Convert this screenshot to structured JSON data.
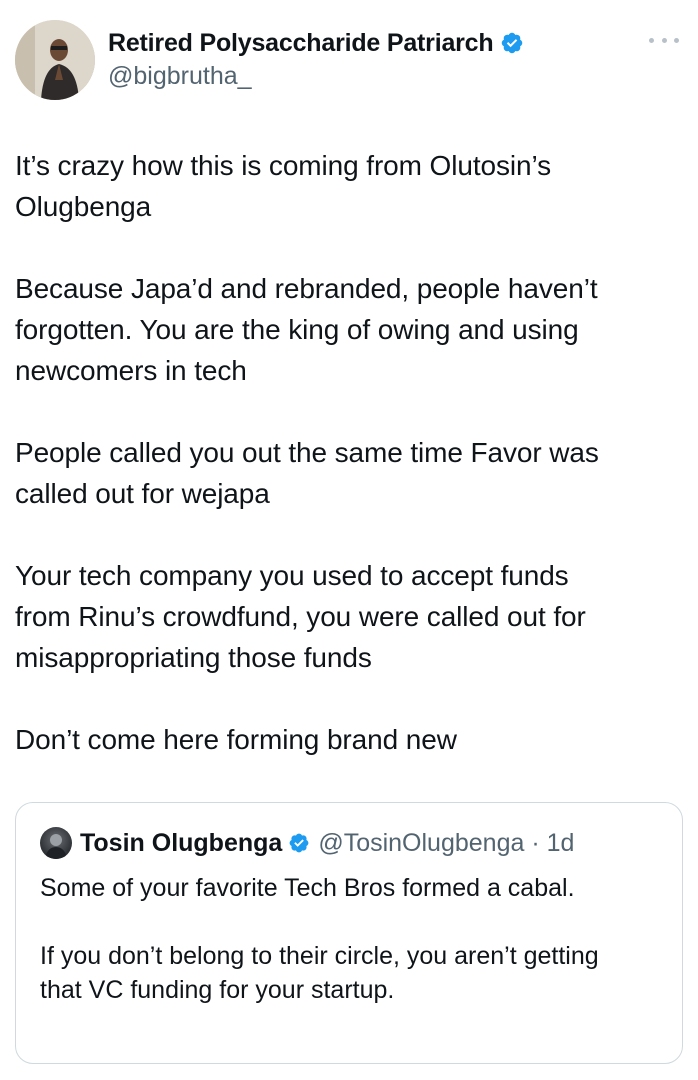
{
  "author": {
    "display_name": "Retired Polysaccharide Patriarch",
    "handle": "@bigbrutha_",
    "verified": true
  },
  "colors": {
    "verified_blue": "#1d9bf0",
    "secondary_text": "#536471",
    "border": "#cfd9de"
  },
  "icons": {
    "more": "more-horizontal-icon",
    "verified": "verified-badge-icon"
  },
  "tweet": {
    "paragraphs": [
      "It’s crazy how this is coming from Olutosin’s\nOlugbenga",
      "Because Japa’d and rebranded, people haven’t\nforgotten. You are the king of owing and using\nnewcomers in tech",
      "People called you out the same time Favor was\ncalled out for wejapa",
      "Your tech company you used to accept funds\nfrom Rinu’s crowdfund, you were called out for\nmisappropriating those funds",
      "Don’t come here forming brand new"
    ]
  },
  "quoted_tweet": {
    "display_name": "Tosin Olugbenga",
    "handle_time": "@TosinOlugbenga · 1d",
    "verified": true,
    "paragraphs": [
      "Some of your favorite Tech Bros formed a cabal.",
      "If you don’t belong to their circle, you aren’t getting\nthat VC funding for your startup."
    ]
  }
}
